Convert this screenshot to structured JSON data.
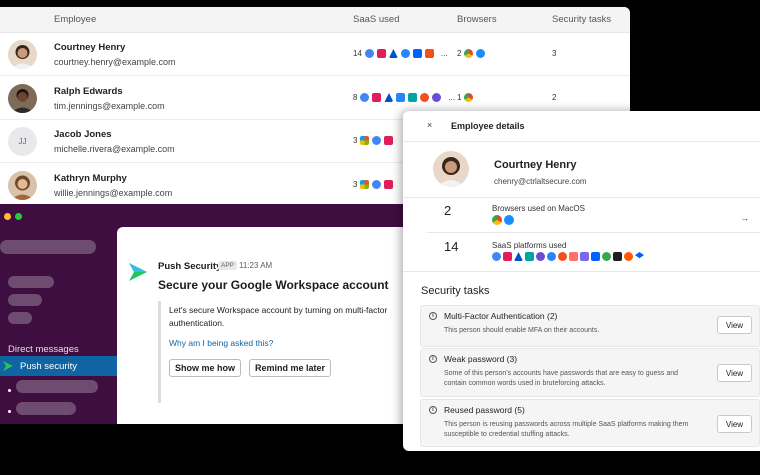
{
  "table": {
    "headers": {
      "employee": "Employee",
      "saas": "SaaS used",
      "browsers": "Browsers",
      "tasks": "Security tasks"
    },
    "rows": [
      {
        "name": "Courtney Henry",
        "email": "courtney.henry@example.com",
        "saas_count": "14",
        "saas_more": "...",
        "browser_count": "2",
        "tasks": "3"
      },
      {
        "name": "Ralph Edwards",
        "email": "tim.jennings@example.com",
        "saas_count": "8",
        "saas_more": "...",
        "browser_count": "1",
        "tasks": "2"
      },
      {
        "name": "Jacob Jones",
        "email": "michelle.rivera@example.com",
        "initials": "JJ",
        "saas_count": "3",
        "tasks": ""
      },
      {
        "name": "Kathryn Murphy",
        "email": "willie.jennings@example.com",
        "saas_count": "3",
        "tasks": ""
      }
    ]
  },
  "slack": {
    "direct_messages_label": "Direct messages",
    "active_dm": "Push security",
    "bot_name": "Push Security",
    "app_badge": "APP",
    "time": "11:23 AM",
    "title": "Secure your Google Workspace account",
    "body": "Let's secure Workspace account by turning on multi-factor authentication.",
    "link": "Why am I being asked this?",
    "buttons": {
      "show": "Show me how",
      "remind": "Remind me later"
    }
  },
  "details": {
    "close": "×",
    "title": "Employee details",
    "name": "Courtney Henry",
    "email": "chenry@ctrlaltsecure.com",
    "browsers": {
      "count": "2",
      "label": "Browsers used on MacOS",
      "arrow": "→"
    },
    "saas": {
      "count": "14",
      "label": "SaaS platforms used"
    },
    "security_heading": "Security tasks",
    "tasks": [
      {
        "title": "Multi-Factor Authentication (2)",
        "desc": "This person should enable MFA on their accounts.",
        "button": "View"
      },
      {
        "title": "Weak password (3)",
        "desc": "Some of this person's accounts have passwords that are easy to guess and contain common words used in bruteforcing attacks.",
        "button": "View"
      },
      {
        "title": "Reused password (5)",
        "desc": "This person is reusing passwords across multiple SaaS platforms making them susceptible to credential stuffing attacks.",
        "button": "View"
      }
    ]
  },
  "colors": {
    "slack_sidebar": "#3f0e40",
    "slack_active": "#1164a3",
    "link_blue": "#1264a3",
    "push_green": "#22c55e"
  }
}
